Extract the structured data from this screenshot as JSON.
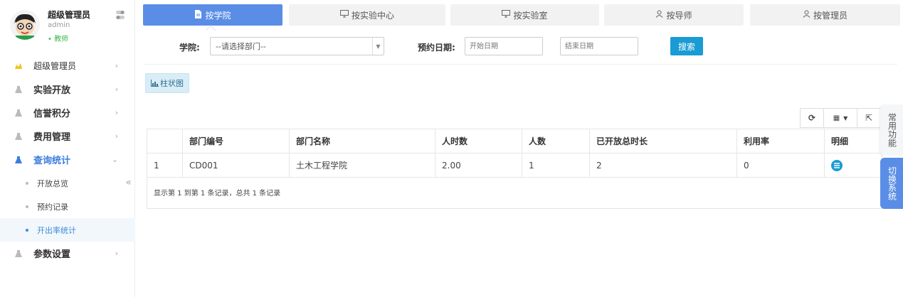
{
  "profile": {
    "name": "超级管理员",
    "role": "admin",
    "status": "• 教师"
  },
  "menu": {
    "items": [
      {
        "label": "超级管理员"
      },
      {
        "label": "实验开放"
      },
      {
        "label": "信誉积分"
      },
      {
        "label": "费用管理"
      },
      {
        "label": "查询统计"
      },
      {
        "label": "参数设置"
      }
    ],
    "sub_items": [
      {
        "label": "开放总览"
      },
      {
        "label": "预约记录"
      },
      {
        "label": "开出率统计"
      }
    ]
  },
  "tabs": [
    {
      "label": "按学院"
    },
    {
      "label": "按实验中心"
    },
    {
      "label": "按实验室"
    },
    {
      "label": "按导师"
    },
    {
      "label": "按管理员"
    }
  ],
  "filter": {
    "college_label": "学院:",
    "college_selected": "--请选择部门--",
    "date_label": "预约日期:",
    "start_placeholder": "开始日期",
    "end_placeholder": "结束日期",
    "search_label": "搜索"
  },
  "chart_button": "柱状图",
  "table": {
    "headers": [
      "",
      "部门编号",
      "部门名称",
      "人时数",
      "人数",
      "已开放总时长",
      "利用率",
      "明细"
    ],
    "rows": [
      [
        "1",
        "CD001",
        "土木工程学院",
        "2.00",
        "1",
        "2",
        "0"
      ]
    ],
    "footer": "显示第 1 到第 1 条记录，总共 1 条记录"
  },
  "float": {
    "common": "常用功能",
    "switch": "切换系统"
  },
  "colors": {
    "accent": "#5a8ee6",
    "search": "#1a9bd3",
    "active_text": "#3b7ddd",
    "status_green": "#3ab54a"
  }
}
